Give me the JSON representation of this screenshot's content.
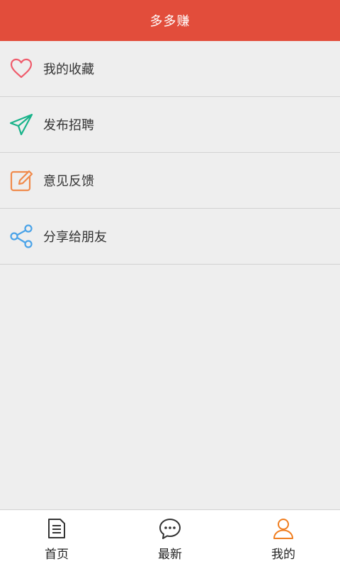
{
  "header": {
    "title": "多多赚"
  },
  "menu": {
    "items": [
      {
        "label": "我的收藏",
        "icon": "heart-icon",
        "color": "#ef5b6b"
      },
      {
        "label": "发布招聘",
        "icon": "paper-plane-icon",
        "color": "#19b38a"
      },
      {
        "label": "意见反馈",
        "icon": "edit-icon",
        "color": "#f08a4b"
      },
      {
        "label": "分享给朋友",
        "icon": "share-icon",
        "color": "#4aa3e8"
      }
    ]
  },
  "tabbar": {
    "items": [
      {
        "label": "首页",
        "icon": "document-icon",
        "active": false
      },
      {
        "label": "最新",
        "icon": "chat-bubble-icon",
        "active": false
      },
      {
        "label": "我的",
        "icon": "user-icon",
        "active": true
      }
    ],
    "active_color": "#f07d1e"
  },
  "colors": {
    "accent": "#e24d3b",
    "background": "#eeeeee"
  }
}
